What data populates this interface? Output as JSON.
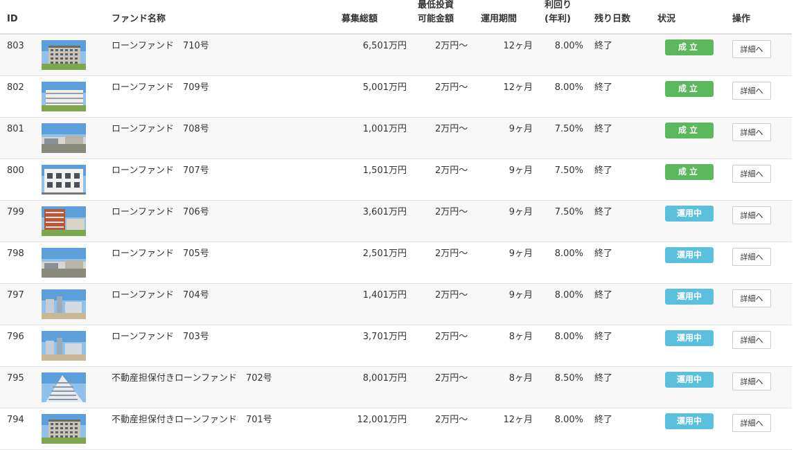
{
  "headers": {
    "id": "ID",
    "fund_name": "ファンド名称",
    "total": "募集総額",
    "min_invest_line1": "最低投資",
    "min_invest_line2": "可能金額",
    "period": "運用期間",
    "yield_line1": "利回り",
    "yield_line2": "(年利)",
    "days_left": "残り日数",
    "status": "状況",
    "action": "操作"
  },
  "rows": [
    {
      "id": "803",
      "name": "ローンファンド　710号",
      "total": "6,501万円",
      "min": "2万円〜",
      "period": "12ヶ月",
      "yield": "8.00%",
      "days": "終了",
      "status": "成立",
      "status_type": "ok",
      "button": "詳細へ",
      "thumb": "building-photo-green"
    },
    {
      "id": "802",
      "name": "ローンファンド　709号",
      "total": "5,001万円",
      "min": "2万円〜",
      "period": "12ヶ月",
      "yield": "8.00%",
      "days": "終了",
      "status": "成立",
      "status_type": "ok",
      "button": "詳細へ",
      "thumb": "building-photo-white"
    },
    {
      "id": "801",
      "name": "ローンファンド　708号",
      "total": "1,001万円",
      "min": "2万円〜",
      "period": "9ヶ月",
      "yield": "7.50%",
      "days": "終了",
      "status": "成立",
      "status_type": "ok",
      "button": "詳細へ",
      "thumb": "street-photo"
    },
    {
      "id": "800",
      "name": "ローンファンド　707号",
      "total": "1,501万円",
      "min": "2万円〜",
      "period": "9ヶ月",
      "yield": "7.50%",
      "days": "終了",
      "status": "成立",
      "status_type": "ok",
      "button": "詳細へ",
      "thumb": "apartment-photo"
    },
    {
      "id": "799",
      "name": "ローンファンド　706号",
      "total": "3,601万円",
      "min": "2万円〜",
      "period": "9ヶ月",
      "yield": "7.50%",
      "days": "終了",
      "status": "運用中",
      "status_type": "run",
      "button": "詳細へ",
      "thumb": "brick-building-photo"
    },
    {
      "id": "798",
      "name": "ローンファンド　705号",
      "total": "2,501万円",
      "min": "2万円〜",
      "period": "9ヶ月",
      "yield": "8.00%",
      "days": "終了",
      "status": "運用中",
      "status_type": "run",
      "button": "詳細へ",
      "thumb": "street-photo"
    },
    {
      "id": "797",
      "name": "ローンファンド　704号",
      "total": "1,401万円",
      "min": "2万円〜",
      "period": "9ヶ月",
      "yield": "8.00%",
      "days": "終了",
      "status": "運用中",
      "status_type": "run",
      "button": "詳細へ",
      "thumb": "city-photo"
    },
    {
      "id": "796",
      "name": "ローンファンド　703号",
      "total": "3,701万円",
      "min": "2万円〜",
      "period": "8ヶ月",
      "yield": "8.00%",
      "days": "終了",
      "status": "運用中",
      "status_type": "run",
      "button": "詳細へ",
      "thumb": "city-photo"
    },
    {
      "id": "795",
      "name": "不動産担保付きローンファンド　702号",
      "total": "8,001万円",
      "min": "2万円〜",
      "period": "8ヶ月",
      "yield": "8.50%",
      "days": "終了",
      "status": "運用中",
      "status_type": "run",
      "button": "詳細へ",
      "thumb": "tower-photo"
    },
    {
      "id": "794",
      "name": "不動産担保付きローンファンド　701号",
      "total": "12,001万円",
      "min": "2万円〜",
      "period": "12ヶ月",
      "yield": "8.00%",
      "days": "終了",
      "status": "運用中",
      "status_type": "run",
      "button": "詳細へ",
      "thumb": "building-photo-green"
    }
  ],
  "colors": {
    "status_ok": "#5cb85c",
    "status_run": "#5bc0de"
  }
}
